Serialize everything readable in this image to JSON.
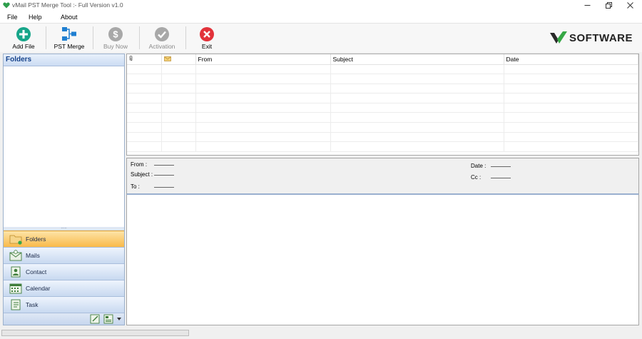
{
  "window": {
    "title": "vMail PST Merge Tool :- Full Version v1.0"
  },
  "menu": [
    "File",
    "Help",
    "About"
  ],
  "toolbar": {
    "add_file": "Add File",
    "pst_merge": "PST Merge",
    "buy_now": "Buy Now",
    "activation": "Activation",
    "exit": "Exit"
  },
  "logo": {
    "brand": "SOFTWARE"
  },
  "folders": {
    "title": "Folders"
  },
  "nav": {
    "folders": "Folders",
    "mails": "Mails",
    "contact": "Contact",
    "calendar": "Calendar",
    "task": "Task"
  },
  "list": {
    "columns": {
      "from": "From",
      "subject": "Subject",
      "date": "Date"
    }
  },
  "preview": {
    "from": "From :",
    "subject": "Subject :",
    "to": "To :",
    "date": "Date :",
    "cc": "Cc :"
  },
  "colors": {
    "accent_orange": "#f9b94a",
    "nav_blue": "#c8d9f0",
    "exit_red": "#e2323a",
    "add_teal": "#17a589"
  }
}
